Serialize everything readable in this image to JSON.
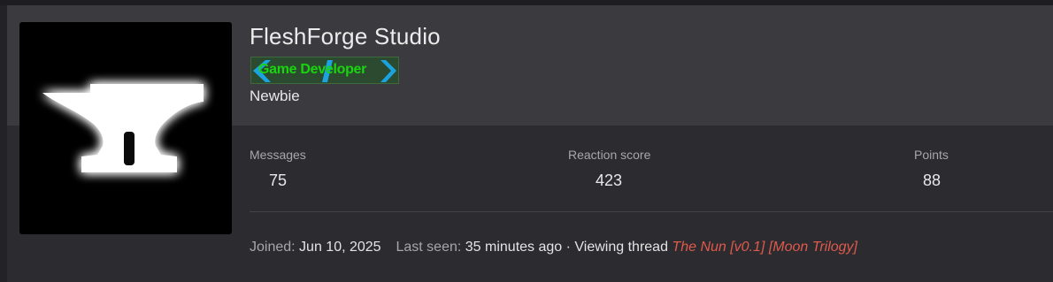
{
  "profile": {
    "username": "FleshForge Studio",
    "banner_text": "Game Developer",
    "user_title": "Newbie",
    "avatar_icon": "anvil-icon"
  },
  "stats": [
    {
      "label": "Messages",
      "value": "75"
    },
    {
      "label": "Reaction score",
      "value": "423"
    },
    {
      "label": "Points",
      "value": "88"
    }
  ],
  "meta": {
    "joined_label": "Joined:",
    "joined_value": "Jun 10, 2025",
    "last_seen_label": "Last seen:",
    "last_seen_value": "35 minutes ago",
    "separator": "·",
    "activity_text": "Viewing thread",
    "thread_title": "The Nun [v0.1] [Moon Trilogy]"
  },
  "colors": {
    "banner_text": "#19d40f",
    "banner_arrows": "#1ba3e0",
    "thread_link": "#e05a4c",
    "header_bg": "#3a3a3f",
    "body_bg": "#2b2b30"
  }
}
